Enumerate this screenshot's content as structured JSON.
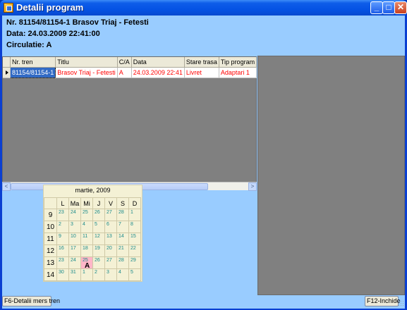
{
  "window": {
    "title": "Detalii program",
    "min_glyph": "_",
    "max_glyph": "□",
    "close_glyph": "✕"
  },
  "info": {
    "line1": "Nr. 81154/81154-1 Brasov Triaj - Fetesti",
    "line2": "Data: 24.03.2009 22:41:00",
    "line3": "Circulatie: A"
  },
  "grid": {
    "columns": [
      "Nr. tren",
      "Titlu",
      "C/A",
      "Data",
      "Stare trasa",
      "Tip program"
    ],
    "rows": [
      [
        "81154/81154-1",
        "Brasov Triaj - Fetesti",
        "A",
        "24.03.2009 22:41",
        "Livret",
        "Adaptari 1"
      ]
    ]
  },
  "scroll": {
    "left_glyph": "<",
    "right_glyph": ">"
  },
  "calendar": {
    "month_label": "martie, 2009",
    "weekdays": [
      "L",
      "Ma",
      "Mi",
      "J",
      "V",
      "S",
      "D"
    ],
    "weeks": [
      {
        "num": "9",
        "days": [
          "23",
          "24",
          "25",
          "26",
          "27",
          "28",
          "1"
        ]
      },
      {
        "num": "10",
        "days": [
          "2",
          "3",
          "4",
          "5",
          "6",
          "7",
          "8"
        ]
      },
      {
        "num": "11",
        "days": [
          "9",
          "10",
          "11",
          "12",
          "13",
          "14",
          "15"
        ]
      },
      {
        "num": "12",
        "days": [
          "16",
          "17",
          "18",
          "19",
          "20",
          "21",
          "22"
        ]
      },
      {
        "num": "13",
        "days": [
          "23",
          "24",
          "25",
          "26",
          "27",
          "28",
          "29"
        ]
      },
      {
        "num": "14",
        "days": [
          "30",
          "31",
          "1",
          "2",
          "3",
          "4",
          "5"
        ]
      }
    ],
    "today_mark": "A"
  },
  "buttons": {
    "f6": "F6-Detalii mers tren",
    "f12": "F12-Inchide"
  },
  "colors": {
    "client_bg": "#99ccff",
    "row_text": "#ff0000",
    "selected_cell": "#316ac5",
    "today_bg": "#ffb6c8"
  }
}
